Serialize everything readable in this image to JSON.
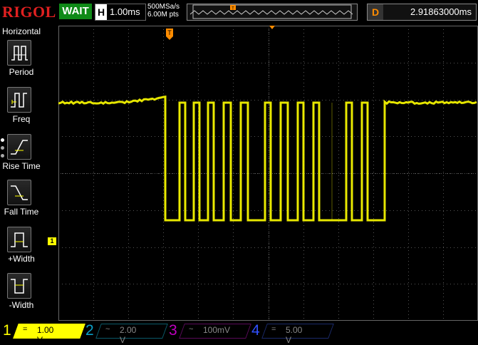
{
  "header": {
    "brand": "RIGOL",
    "run_status": "WAIT",
    "horizontal_letter": "H",
    "timebase": "1.00ms",
    "sample_rate": "500MSa/s",
    "memory_depth": "6.00M pts",
    "trigger_letter": "D",
    "trigger_delay": "2.91863000ms"
  },
  "menu": {
    "title": "Horizontal",
    "items": [
      {
        "label": "Period",
        "icon": "period-icon"
      },
      {
        "label": "Freq",
        "icon": "frequency-icon"
      },
      {
        "label": "Rise Time",
        "icon": "rise-time-icon"
      },
      {
        "label": "Fall Time",
        "icon": "fall-time-icon"
      },
      {
        "label": "+Width",
        "icon": "positive-width-icon"
      },
      {
        "label": "-Width",
        "icon": "negative-width-icon"
      }
    ]
  },
  "channels": [
    {
      "number": "1",
      "coupling": "=",
      "scale": "1.00 V",
      "color": "#ffff00",
      "active": true
    },
    {
      "number": "2",
      "coupling": "~",
      "scale": "2.00 V",
      "color": "#00c8ff",
      "active": false
    },
    {
      "number": "3",
      "coupling": "~",
      "scale": "100mV",
      "color": "#ff00ff",
      "active": false
    },
    {
      "number": "4",
      "coupling": "=",
      "scale": "5.00 V",
      "color": "#2040ff",
      "active": false
    }
  ],
  "markers": {
    "channel_ground_label": "1",
    "trigger_position_label": "T"
  },
  "colors": {
    "trace": "#ffff00",
    "grid": "#555555",
    "wait_bg": "#0f8a18",
    "brand": "#e02020",
    "trigger_marker": "#ff8c00"
  }
}
